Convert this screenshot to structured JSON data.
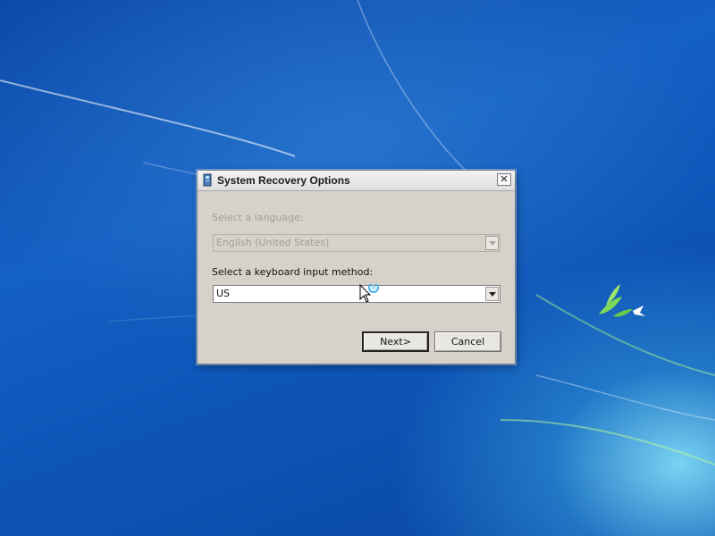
{
  "window": {
    "title": "System Recovery Options",
    "close_glyph": "✕",
    "icon": "recovery-app-icon"
  },
  "language": {
    "label": "Select a language:",
    "value": "English (United States)",
    "enabled": false
  },
  "keyboard": {
    "label": "Select a keyboard input method:",
    "value": "US",
    "enabled": true
  },
  "buttons": {
    "next_label": "Next>",
    "cancel_label": "Cancel"
  },
  "colors": {
    "desktop": "#1560c4",
    "dialog": "#d6d2ca",
    "disabled_text": "#a29f99"
  }
}
